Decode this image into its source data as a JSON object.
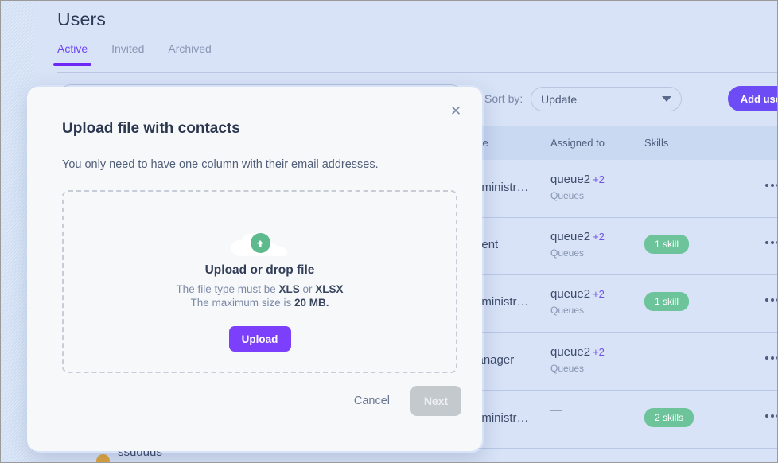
{
  "page": {
    "title": "Users",
    "tabs": [
      {
        "label": "Active",
        "active": true
      },
      {
        "label": "Invited",
        "active": false
      },
      {
        "label": "Archived",
        "active": false
      }
    ]
  },
  "toolbar": {
    "sort_label": "Sort by:",
    "sort_value": "Update",
    "sort_caret_icon": "chevron-down-icon",
    "add_users_label": "Add users"
  },
  "table": {
    "columns": [
      "Role",
      "Assigned to",
      "Skills"
    ],
    "rows": [
      {
        "role": "Administr…",
        "assigned": "queue2",
        "assigned_more": "+2",
        "assigned_sub": "Queues",
        "skills": "",
        "menu_icon": "kebab-menu-icon"
      },
      {
        "role": "Agent",
        "assigned": "queue2",
        "assigned_more": "+2",
        "assigned_sub": "Queues",
        "skills": "1 skill",
        "menu_icon": "kebab-menu-icon"
      },
      {
        "role": "Administr…",
        "assigned": "queue2",
        "assigned_more": "+2",
        "assigned_sub": "Queues",
        "skills": "1 skill",
        "menu_icon": "kebab-menu-icon"
      },
      {
        "role": "Manager",
        "assigned": "queue2",
        "assigned_more": "+2",
        "assigned_sub": "Queues",
        "skills": "",
        "menu_icon": "kebab-menu-icon"
      },
      {
        "role": "Administr…",
        "assigned": "—",
        "assigned_more": "",
        "assigned_sub": "",
        "skills": "2 skills",
        "menu_icon": "kebab-menu-icon"
      }
    ],
    "clipped_row_name": "ssuduus"
  },
  "modal": {
    "close_icon": "close-icon",
    "close_glyph": "✕",
    "title": "Upload file with contacts",
    "subtitle": "You only need to have one column with their email addresses.",
    "dropzone": {
      "icon": "cloud-upload-icon",
      "title": "Upload or drop file",
      "line1_prefix": "The file type must be ",
      "line1_type1": "XLS",
      "line1_mid": " or ",
      "line1_type2": "XLSX",
      "line2_prefix": "The maximum size is ",
      "line2_size": "20 MB.",
      "upload_label": "Upload"
    },
    "cancel_label": "Cancel",
    "next_label": "Next"
  },
  "colors": {
    "accent_purple": "#6d4bf5",
    "upload_purple": "#7c3ffb",
    "tab_active": "#6d46f2",
    "badge_green": "#6dc49a",
    "page_bg": "#d8e3f7",
    "modal_bg": "#f7f8fa",
    "next_disabled": "#c4c9ce",
    "link_plus": "#6f52e8"
  }
}
